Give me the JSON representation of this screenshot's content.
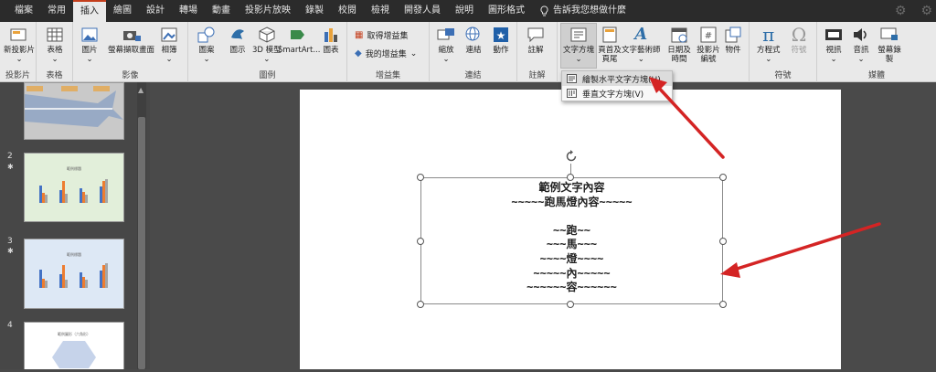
{
  "menu": {
    "tabs": [
      "檔案",
      "常用",
      "插入",
      "繪圖",
      "設計",
      "轉場",
      "動畫",
      "投影片放映",
      "錄製",
      "校閱",
      "檢視",
      "開發人員",
      "說明",
      "圖形格式"
    ],
    "search_text": "告訴我您想做什麼"
  },
  "ribbon": {
    "new_slide": "新投影片",
    "table": "表格",
    "pictures": "圖片",
    "screenshot": "螢幕擷取畫面",
    "album": "相簿",
    "shapes": "圖案",
    "icons": "圖示",
    "models_3d": "3D 模型",
    "smartart": "SmartArt...",
    "chart": "圖表",
    "get_addins": "取得增益集",
    "my_addins": "我的增益集",
    "zoom": "縮放",
    "link": "連結",
    "action": "動作",
    "comment": "註解",
    "textbox": "文字方塊",
    "header_footer": "頁首及頁尾",
    "wordart": "文字藝術師",
    "date_time": "日期及時間",
    "slide_number": "投影片編號",
    "object": "物件",
    "equation": "方程式",
    "symbol": "符號",
    "video": "視訊",
    "audio": "音訊",
    "screen_recording": "螢幕錄製",
    "groups": {
      "slides": "投影片",
      "tables": "表格",
      "images": "影像",
      "illustrations": "圖例",
      "addins": "增益集",
      "links": "連結",
      "comments": "註解",
      "symbols": "符號",
      "media": "媒體"
    }
  },
  "dropdown": {
    "horizontal": "繪製水平文字方塊(H)",
    "vertical": "垂直文字方塊(V)"
  },
  "slides": {
    "num2": "2",
    "num3": "3",
    "num4": "4",
    "thumb_title": "範例標題",
    "thumb4_title": "範例圖形（六角形）"
  },
  "textbox_lines": [
    "範例文字內容",
    "~~~~~跑馬燈內容~~~~~",
    "",
    "~~跑~~",
    "~~~馬~~~",
    "~~~~燈~~~~",
    "~~~~~內~~~~~",
    "~~~~~~容~~~~~~"
  ],
  "colors": {
    "accent": "#c43e1c",
    "arrow": "#d42424",
    "bar_blue": "#4472c4",
    "bar_orange": "#ed7d31",
    "bar_gray": "#a5a5a5",
    "thumb2_bg": "#e2efda",
    "thumb3_bg": "#dde8f5"
  }
}
